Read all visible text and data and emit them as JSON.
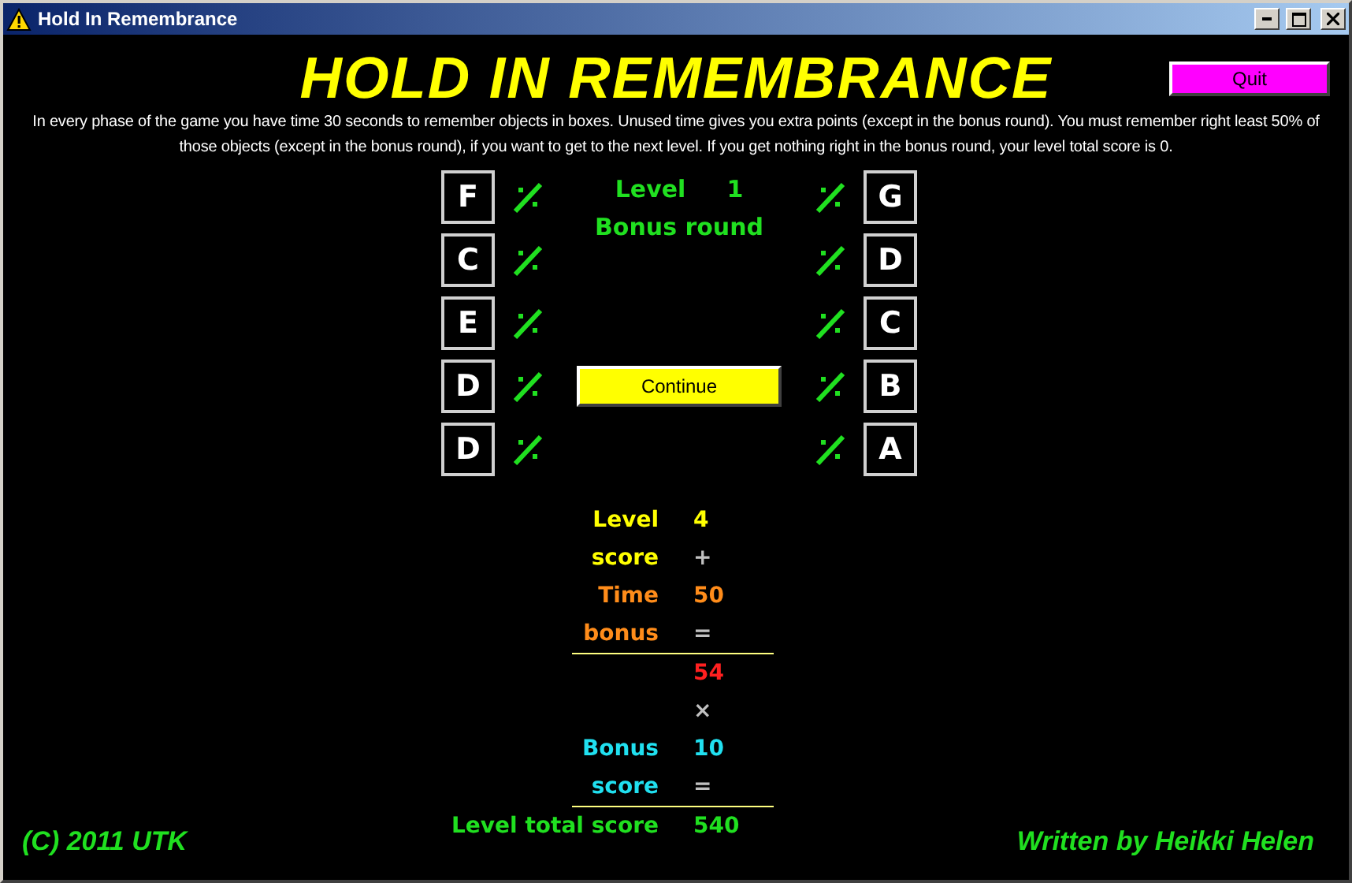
{
  "window": {
    "title": "Hold In Remembrance"
  },
  "header": {
    "title": "HOLD IN REMEMBRANCE",
    "quit_button": "Quit"
  },
  "instructions": "In every phase of the game you have time 30 seconds to remember objects in boxes. Unused time gives you extra points (except in the bonus round). You must remember right least 50% of those objects (except in the bonus round), if you want to get to the next level. If you get nothing right in the bonus round, your level total score is 0.",
  "left_boxes": [
    "F",
    "C",
    "E",
    "D",
    "D"
  ],
  "right_boxes": [
    "G",
    "D",
    "C",
    "B",
    "A"
  ],
  "round": {
    "level_label": "Level",
    "level_value": "1",
    "subtitle": "Bonus round"
  },
  "continue_button": "Continue",
  "score_groups": [
    {
      "rows": [
        {
          "label": {
            "text": "Level",
            "color": "#ffff00"
          },
          "amount": {
            "text": "4",
            "color": "#ffff00"
          }
        },
        {
          "label": {
            "text": "score",
            "color": "#ffff00"
          },
          "amount": {
            "text": "+",
            "color": "#c0c0c0"
          }
        },
        {
          "label": {
            "text": "Time",
            "color": "#ff8c1a"
          },
          "amount": {
            "text": "50",
            "color": "#ff8c1a"
          }
        },
        {
          "label": {
            "text": "bonus",
            "color": "#ff8c1a"
          },
          "amount": {
            "text": "=",
            "color": "#c0c0c0"
          }
        }
      ]
    },
    {
      "rows": [
        {
          "amount": {
            "text": "54",
            "color": "#ff2020"
          }
        },
        {
          "amount": {
            "text": "×",
            "color": "#c0c0c0"
          }
        },
        {
          "label": {
            "text": "Bonus",
            "color": "#20e0f0"
          },
          "amount": {
            "text": "10",
            "color": "#20e0f0"
          }
        },
        {
          "label": {
            "text": "score",
            "color": "#20e0f0"
          },
          "amount": {
            "text": "=",
            "color": "#c0c0c0"
          }
        }
      ]
    },
    {
      "rows": [
        {
          "label": {
            "text": "Level total score",
            "color": "#20e020"
          },
          "amount": {
            "text": "540",
            "color": "#20e020"
          }
        }
      ]
    }
  ],
  "footer": {
    "copyright": "(C) 2011 UTK",
    "author": "Written by Heikki Helen"
  }
}
